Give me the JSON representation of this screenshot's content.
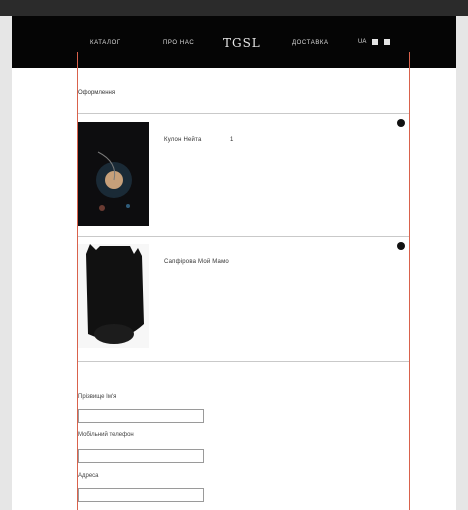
{
  "browser": {
    "breadcrumb": ""
  },
  "nav": {
    "left_items": [
      "КАТАЛОГ",
      "ПРО НАС"
    ],
    "logo": "TGSL",
    "right_items": [
      "ДОСТАВКА"
    ],
    "lang": "UA"
  },
  "cart": {
    "title": "Оформлення",
    "items": [
      {
        "name": "Кулон Нейта",
        "qty": "1",
        "sub": ""
      },
      {
        "name": "Сапфірова Мой Мамо",
        "sub": ""
      }
    ]
  },
  "form": {
    "fields": [
      {
        "label": "Прізвище Ім'я"
      },
      {
        "label": "Мобільний телефон"
      },
      {
        "label": "Адреса"
      }
    ]
  }
}
